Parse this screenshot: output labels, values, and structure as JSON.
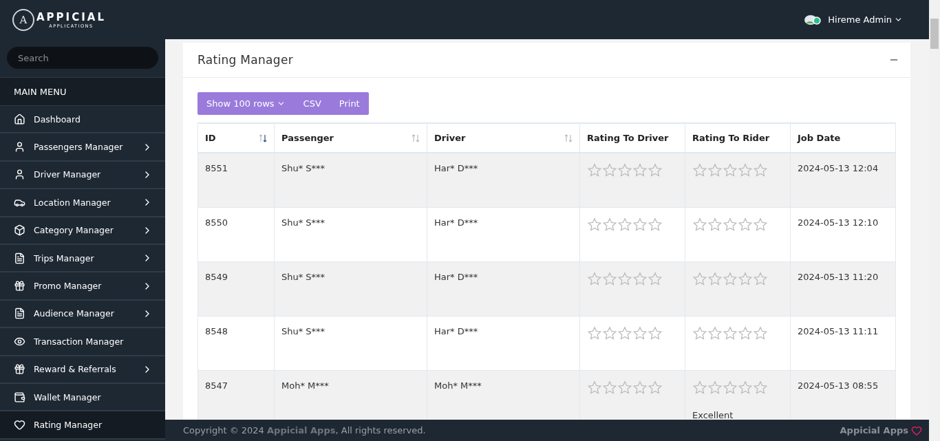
{
  "logo": {
    "mark": "A",
    "name": "APPICIAL",
    "tagline": "APPLICATIONS"
  },
  "header": {
    "user": "Hireme Admin"
  },
  "sidebar": {
    "search": {
      "placeholder": "Search"
    },
    "section": "MAIN MENU",
    "items": [
      {
        "label": "Dashboard",
        "has_submenu": false,
        "selected": false
      },
      {
        "label": "Passengers Manager",
        "has_submenu": true,
        "selected": false
      },
      {
        "label": "Driver Manager",
        "has_submenu": true,
        "selected": false
      },
      {
        "label": "Location Manager",
        "has_submenu": true,
        "selected": false
      },
      {
        "label": "Category Manager",
        "has_submenu": true,
        "selected": false
      },
      {
        "label": "Trips Manager",
        "has_submenu": true,
        "selected": false
      },
      {
        "label": "Promo Manager",
        "has_submenu": true,
        "selected": false
      },
      {
        "label": "Audience Manager",
        "has_submenu": true,
        "selected": false
      },
      {
        "label": "Transaction Manager",
        "has_submenu": false,
        "selected": false
      },
      {
        "label": "Reward & Referrals",
        "has_submenu": true,
        "selected": false
      },
      {
        "label": "Wallet Manager",
        "has_submenu": false,
        "selected": false
      },
      {
        "label": "Rating Manager",
        "has_submenu": false,
        "selected": true
      }
    ]
  },
  "card": {
    "title": "Rating Manager",
    "toolbar": [
      "Show 100 rows",
      "CSV",
      "Print"
    ]
  },
  "table": {
    "columns": [
      {
        "label": "ID",
        "sortable": true,
        "sorted_descending": true
      },
      {
        "label": "Passenger",
        "sortable": true,
        "sorted_descending": false
      },
      {
        "label": "Driver",
        "sortable": true,
        "sorted_descending": false
      },
      {
        "label": "Rating To Driver",
        "sortable": false
      },
      {
        "label": "Rating To Rider",
        "sortable": false
      },
      {
        "label": "Job Date",
        "sortable": false
      }
    ],
    "rows": [
      {
        "id": "8551",
        "passenger": "Shu* S***",
        "driver": "Har* D***",
        "driver_rating": {
          "stars": 0
        },
        "rider_rating": {
          "stars": 0
        },
        "date": "2024-05-13 12:04"
      },
      {
        "id": "8550",
        "passenger": "Shu* S***",
        "driver": "Har* D***",
        "driver_rating": {
          "stars": 0
        },
        "rider_rating": {
          "stars": 0
        },
        "date": "2024-05-13 12:10"
      },
      {
        "id": "8549",
        "passenger": "Shu* S***",
        "driver": "Har* D***",
        "driver_rating": {
          "stars": 0
        },
        "rider_rating": {
          "stars": 0
        },
        "date": "2024-05-13 11:20"
      },
      {
        "id": "8548",
        "passenger": "Shu* S***",
        "driver": "Har* D***",
        "driver_rating": {
          "stars": 0
        },
        "rider_rating": {
          "stars": 0
        },
        "date": "2024-05-13 11:11"
      },
      {
        "id": "8547",
        "passenger": "Moh* M***",
        "driver": "Moh* M***",
        "driver_rating": {
          "stars": 0
        },
        "rider_rating": {
          "stars": 0,
          "comment": "Excellent"
        },
        "date": "2024-05-13 08:55"
      }
    ]
  },
  "footer": {
    "copyright": "Copyright © 2024 **Appicial Apps**, All rights reserved.",
    "brand": "Appicial Apps"
  }
}
